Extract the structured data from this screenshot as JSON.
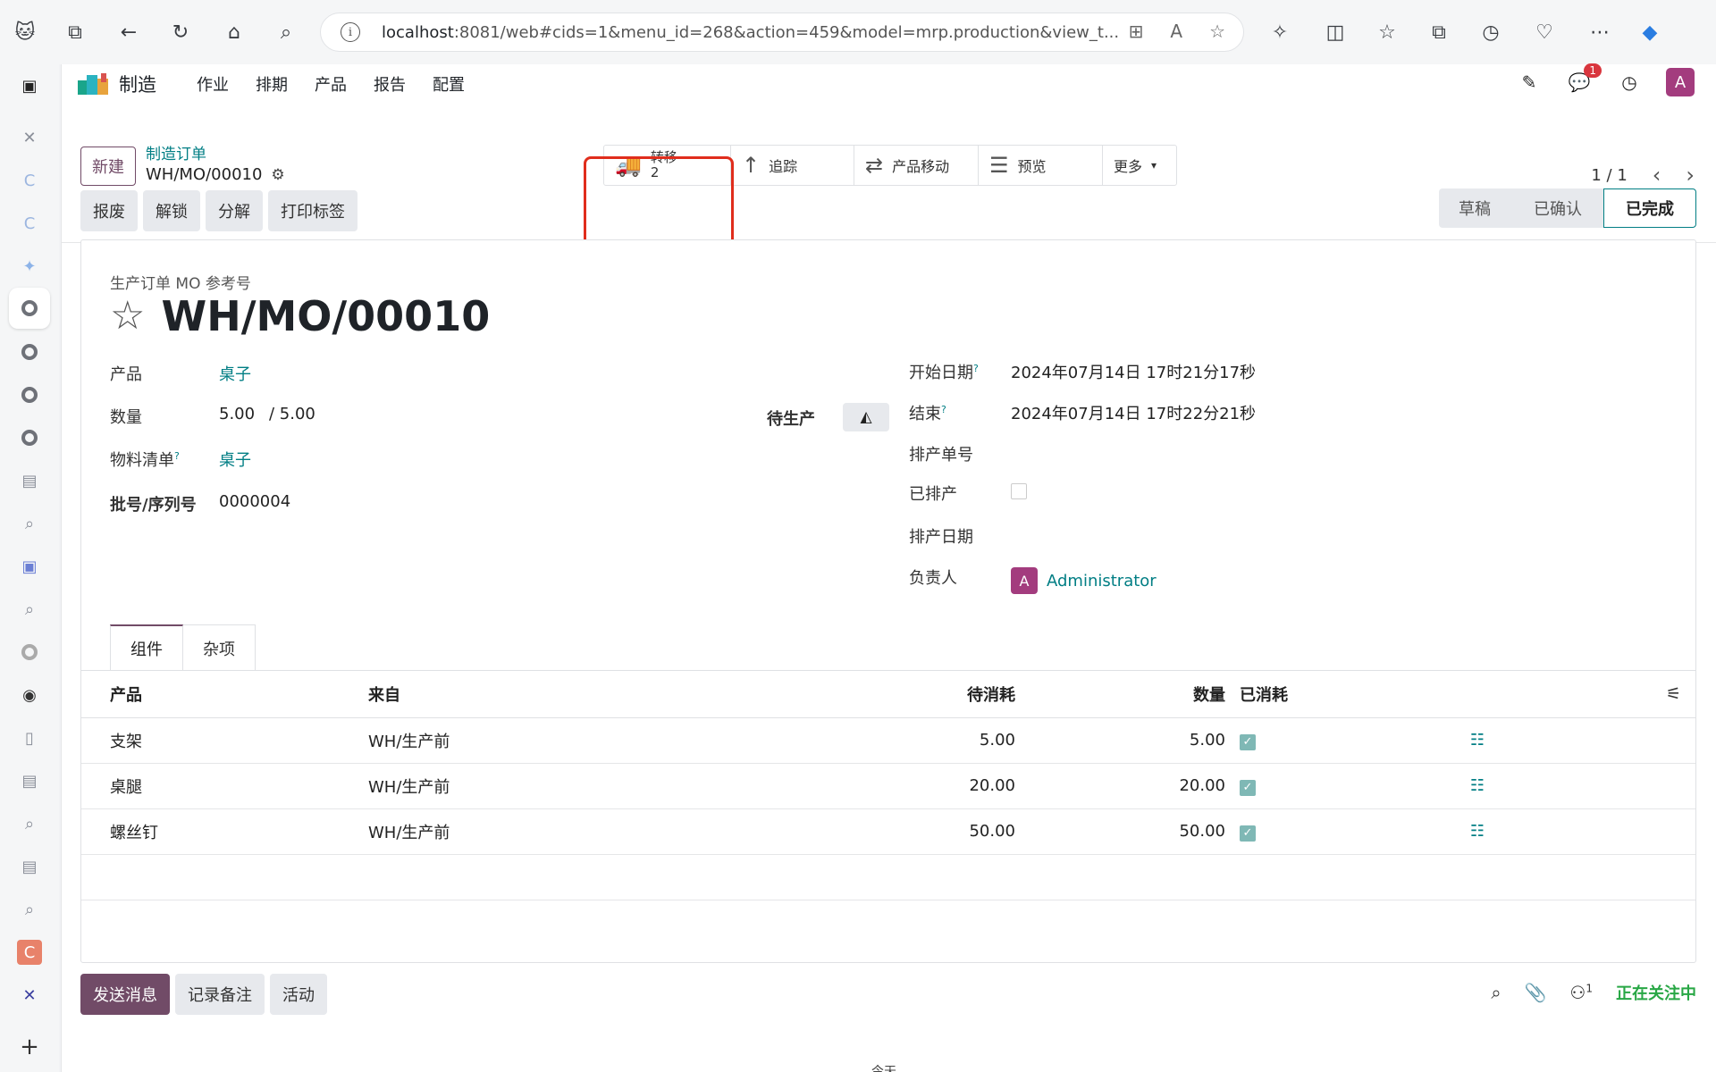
{
  "browser": {
    "url_host": "localhost",
    "url_rest": ":8081/web#cids=1&menu_id=268&action=459&model=mrp.production&view_t..."
  },
  "app": {
    "brand": "制造",
    "menu": [
      "作业",
      "排期",
      "产品",
      "报告",
      "配置"
    ],
    "chat_badge": "1",
    "user_initial": "A"
  },
  "control": {
    "new_label": "新建",
    "breadcrumb_parent": "制造订单",
    "breadcrumb_current": "WH/MO/00010",
    "smart_buttons": {
      "transfer_label": "转移",
      "transfer_count": "2",
      "trace_label": "追踪",
      "moves_label": "产品移动",
      "preview_label": "预览",
      "more_label": "更多"
    },
    "pager": "1 / 1"
  },
  "actions": [
    "报废",
    "解锁",
    "分解",
    "打印标签"
  ],
  "statusbar": {
    "draft": "草稿",
    "confirmed": "已确认",
    "done": "已完成"
  },
  "form": {
    "ref_label": "生产订单 MO 参考号",
    "title": "WH/MO/00010",
    "product_label": "产品",
    "product_value": "桌子",
    "qty_label": "数量",
    "qty_value": "5.00",
    "qty_total": "/ 5.00",
    "to_produce_label": "待生产",
    "bom_label": "物料清单",
    "bom_value": "桌子",
    "lot_label": "批号/序列号",
    "lot_value": "0000004",
    "start_label": "开始日期",
    "start_value": "2024年07月14日 17时21分17秒",
    "end_label": "结束",
    "end_value": "2024年07月14日 17时22分21秒",
    "schedule_no_label": "排产单号",
    "scheduled_label": "已排产",
    "schedule_date_label": "排产日期",
    "responsible_label": "负责人",
    "responsible_initial": "A",
    "responsible_value": "Administrator"
  },
  "tabs": [
    "组件",
    "杂项"
  ],
  "components": {
    "headers": {
      "product": "产品",
      "from": "来自",
      "to_consume": "待消耗",
      "quantity": "数量",
      "consumed": "已消耗"
    },
    "rows": [
      {
        "product": "支架",
        "from": "WH/生产前",
        "to_consume": "5.00",
        "quantity": "5.00"
      },
      {
        "product": "桌腿",
        "from": "WH/生产前",
        "to_consume": "20.00",
        "quantity": "20.00"
      },
      {
        "product": "螺丝钉",
        "from": "WH/生产前",
        "to_consume": "50.00",
        "quantity": "50.00"
      }
    ]
  },
  "chatter": {
    "send_message": "发送消息",
    "log_note": "记录备注",
    "activity": "活动",
    "followers_count": "1",
    "following": "正在关注中",
    "bottom_text": "今天"
  },
  "colors": {
    "brand": "#714b67",
    "link": "#017e84",
    "highlight": "#e02d1c"
  }
}
